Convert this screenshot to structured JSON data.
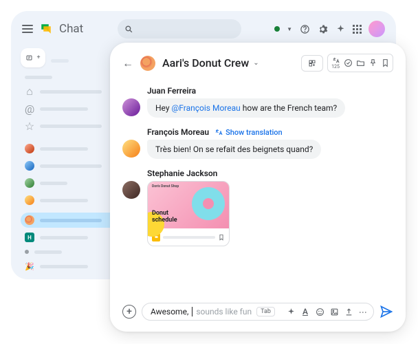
{
  "app": {
    "title": "Chat"
  },
  "header_count": "125",
  "space": {
    "name": "Aari's Donut Crew"
  },
  "messages": [
    {
      "author": "Juan Ferreira",
      "text_before": "Hey ",
      "mention": "@François Moreau",
      "text_after": " how are the French team?"
    },
    {
      "author": "François Moreau",
      "translate": "Show translation",
      "text": "Très bien! On se refait des beignets quand?"
    },
    {
      "author": "Stephanie Jackson",
      "card_brand": "Don's Donut Shop",
      "card_title_1": "Donut",
      "card_title_2": "schedule"
    }
  ],
  "composer": {
    "typed": "Awesome,",
    "suggestion": " sounds like fun",
    "tab": "Tab"
  }
}
